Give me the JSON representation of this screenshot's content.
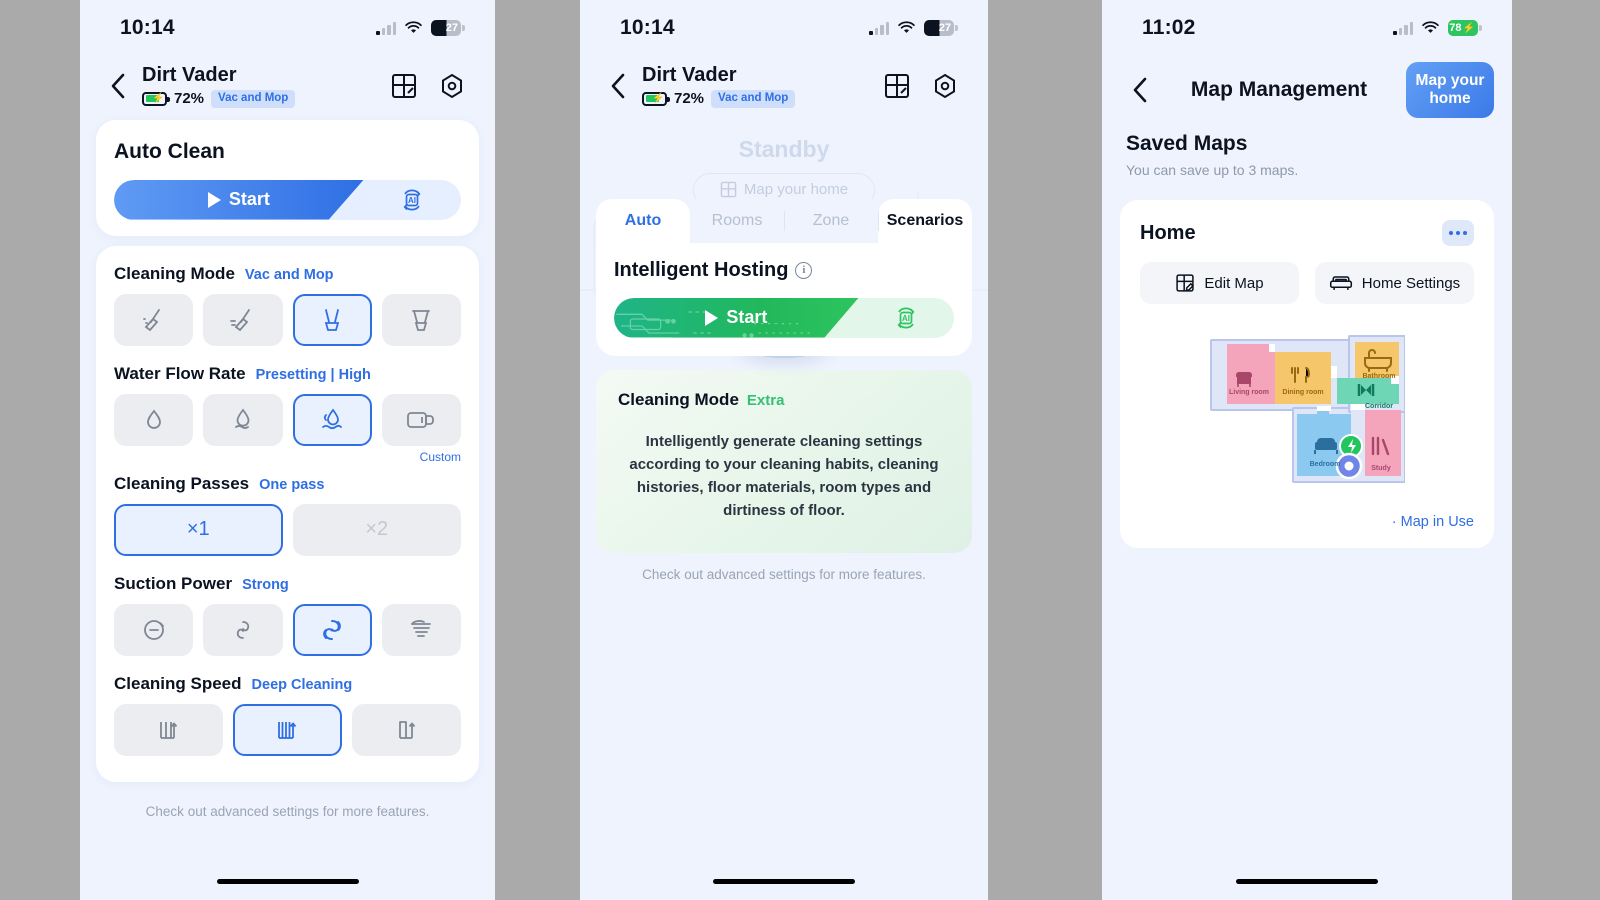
{
  "phone1": {
    "status": {
      "time": "10:14",
      "battery_level": "27",
      "wifi": "wifi-icon",
      "signal": "signal-icon"
    },
    "header": {
      "back": "back-chevron",
      "device_name": "Dirt Vader",
      "battery_pct": "72%",
      "mode_chip": "Vac and Mop",
      "icons": [
        "map-grid-icon",
        "settings-gear-icon"
      ]
    },
    "auto_clean": {
      "title": "Auto Clean",
      "start_label": "Start",
      "ai_label": "AI"
    },
    "settings": [
      {
        "title": "Cleaning Mode",
        "value": "Vac and Mop",
        "columns": 4,
        "selected_index": 2,
        "options": [
          "vac-only-icon",
          "mop-only-icon",
          "vac-and-mop-icon",
          "mop-after-vac-icon"
        ]
      },
      {
        "title": "Water Flow Rate",
        "value": "Presetting | High",
        "columns": 4,
        "selected_index": 2,
        "custom_label": "Custom",
        "options": [
          "water-low-icon",
          "water-medium-icon",
          "water-high-icon",
          "water-custom-icon"
        ]
      },
      {
        "title": "Cleaning Passes",
        "value": "One pass",
        "columns": 2,
        "selected_index": 0,
        "options": [
          "×1",
          "×2"
        ]
      },
      {
        "title": "Suction Power",
        "value": "Strong",
        "columns": 4,
        "selected_index": 2,
        "options": [
          "suction-quiet-icon",
          "suction-standard-icon",
          "suction-strong-icon",
          "suction-max-icon"
        ]
      },
      {
        "title": "Cleaning Speed",
        "value": "Deep Cleaning",
        "columns": 3,
        "selected_index": 1,
        "options": [
          "speed-fast-icon",
          "speed-deep-icon",
          "speed-standard-icon"
        ]
      }
    ],
    "footnote": "Check out advanced settings for more features."
  },
  "phone2": {
    "status": {
      "time": "10:14",
      "battery_level": "27"
    },
    "header": {
      "device_name": "Dirt Vader",
      "battery_pct": "72%",
      "mode_chip": "Vac and Mop"
    },
    "state_label": "Standby",
    "map_home_pill": "Map your home",
    "tabs": [
      {
        "label": "Auto",
        "state": "active"
      },
      {
        "label": "Rooms",
        "state": "inactive"
      },
      {
        "label": "Zone",
        "state": "inactive"
      },
      {
        "label": "Scenarios",
        "state": "dark"
      }
    ],
    "intelligent_hosting": {
      "title": "Intelligent Hosting",
      "info": "i",
      "start_label": "Start",
      "ai_label": "AI"
    },
    "cleaning_mode_card": {
      "title": "Cleaning Mode",
      "value": "Extra",
      "description": "Intelligently generate cleaning settings according to your cleaning habits, cleaning histories, floor materials, room types and dirtiness of floor."
    },
    "footnote": "Check out advanced settings for more features."
  },
  "phone3": {
    "status": {
      "time": "11:02",
      "battery_level": "78"
    },
    "header": {
      "title": "Map Management",
      "map_home_button": "Map your home"
    },
    "saved_maps": {
      "title": "Saved Maps",
      "subtitle": "You can save up to 3 maps."
    },
    "map_card": {
      "name": "Home",
      "more": "more-options",
      "edit_map": "Edit Map",
      "home_settings": "Home Settings",
      "map_in_use": "· Map in Use",
      "rooms": [
        {
          "name": "Living room",
          "color": "#f4a5bc",
          "text": "#a8476a",
          "icon": "sofa-icon"
        },
        {
          "name": "Dining room",
          "color": "#f6c66a",
          "text": "#9a6a12",
          "icon": "cutlery-icon"
        },
        {
          "name": "Bathroom",
          "color": "#f6c66a",
          "text": "#9a6a12",
          "icon": "bathtub-icon"
        },
        {
          "name": "Corridor",
          "color": "#6ed6b4",
          "text": "#0f7a5e",
          "icon": "corridor-icon"
        },
        {
          "name": "Bedroom",
          "color": "#8cc9f0",
          "text": "#2b6f9e",
          "icon": "bed-icon"
        },
        {
          "name": "Study",
          "color": "#f4a5bc",
          "text": "#a8476a",
          "icon": "books-icon"
        }
      ],
      "markers": [
        "charging-dock-icon",
        "robot-position-icon"
      ]
    }
  },
  "colors": {
    "accent_blue": "#2f6fe4",
    "accent_green": "#2ec45f",
    "page_bg": "#eef3fd",
    "gap_gray": "#aaaaaa"
  }
}
